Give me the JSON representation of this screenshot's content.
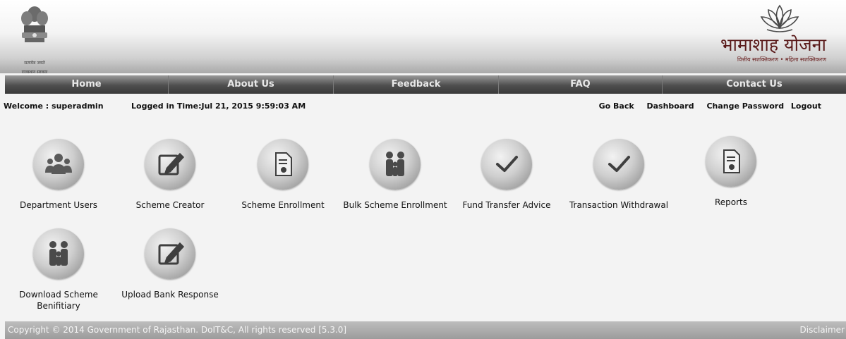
{
  "header": {
    "emblem_motto": "सत्यमेव जयते",
    "emblem_state": "राजस्थान सरकार",
    "brand_name": "भामाशाह योजना",
    "brand_tagline": "वित्तीय सशक्तिकरण • महिला सशक्तिकरण"
  },
  "nav": [
    {
      "label": "Home"
    },
    {
      "label": "About Us"
    },
    {
      "label": "Feedback"
    },
    {
      "label": "FAQ"
    },
    {
      "label": "Contact Us"
    }
  ],
  "info": {
    "welcome": "Welcome : superadmin",
    "logged": "Logged in Time:Jul 21, 2015 9:59:03 AM",
    "go_back": "Go Back",
    "dashboard": "Dashboard",
    "change_password": "Change Password",
    "logout": "Logout"
  },
  "tiles": [
    {
      "label": "Department Users",
      "icon": "department-users-icon"
    },
    {
      "label": "Scheme Creator",
      "icon": "edit-icon"
    },
    {
      "label": "Scheme Enrollment",
      "icon": "document-icon"
    },
    {
      "label": "Bulk Scheme Enrollment",
      "icon": "family-icon"
    },
    {
      "label": "Fund Transfer Advice",
      "icon": "checkmark-icon"
    },
    {
      "label": "Transaction Withdrawal",
      "icon": "checkmark-icon"
    },
    {
      "label": "Reports",
      "icon": "document-icon"
    },
    {
      "label": "Download Scheme Benifitiary",
      "icon": "family-icon"
    },
    {
      "label": "Upload Bank Response",
      "icon": "edit-icon"
    }
  ],
  "footer": {
    "copyright": "Copyright © 2014 Government of Rajasthan. DoIT&C, All rights reserved [5.3.0]",
    "disclaimer": "Disclaimer"
  }
}
